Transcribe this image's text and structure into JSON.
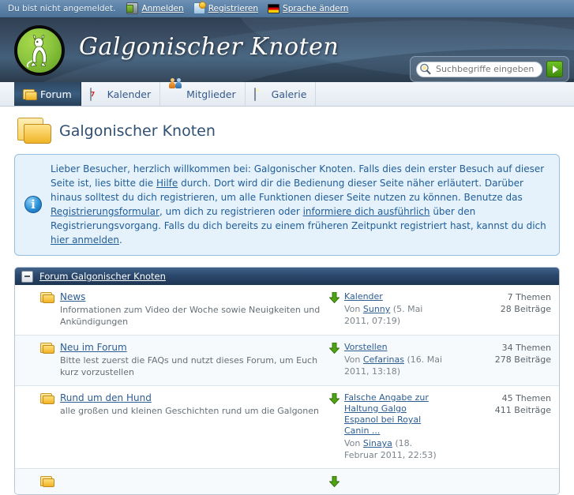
{
  "topbar": {
    "status_text": "Du bist nicht angemeldet.",
    "links": [
      {
        "label": "Anmelden",
        "icon": "login-icon"
      },
      {
        "label": "Registrieren",
        "icon": "register-icon"
      },
      {
        "label": "Sprache ändern",
        "icon": "german-flag-icon"
      }
    ]
  },
  "banner": {
    "site_title": "Galgonischer Knoten",
    "logo_icon": "galgo-dog-logo",
    "accent_green": "#8cc63f",
    "header_dark": "#2f3f52"
  },
  "search": {
    "placeholder": "Suchbegriffe eingeben",
    "value": "",
    "icon": "magnifier-icon",
    "submit_icon": "green-play-arrow-icon"
  },
  "tabs": [
    {
      "label": "Forum",
      "icon": "folder-icon",
      "active": true
    },
    {
      "label": "Kalender",
      "icon": "calendar-icon",
      "active": false,
      "day": "7"
    },
    {
      "label": "Mitglieder",
      "icon": "users-icon",
      "active": false
    },
    {
      "label": "Galerie",
      "icon": "image-icon",
      "active": false
    }
  ],
  "page": {
    "title": "Galgonischer Knoten",
    "icon": "open-folders-icon"
  },
  "notice": {
    "icon": "info-icon",
    "segments": [
      {
        "text": "Lieber Besucher, herzlich willkommen bei: Galgonischer Knoten. Falls dies dein erster Besuch auf dieser Seite ist, lies bitte die ",
        "link": false
      },
      {
        "text": "Hilfe",
        "link": true
      },
      {
        "text": " durch. Dort wird dir die Bedienung dieser Seite näher erläutert. Darüber hinaus solltest du dich registrieren, um alle Funktionen dieser Seite nutzen zu können. Benutze das ",
        "link": false
      },
      {
        "text": "Registrierungsformular",
        "link": true
      },
      {
        "text": ", um dich zu registrieren oder ",
        "link": false
      },
      {
        "text": "informiere dich ausführlich",
        "link": true
      },
      {
        "text": " über den Registrierungsvorgang. Falls du dich bereits zu einem früheren Zeitpunkt registriert hast, kannst du dich ",
        "link": false
      },
      {
        "text": "hier anmelden",
        "link": true
      },
      {
        "text": ".",
        "link": false
      }
    ]
  },
  "board": {
    "header_title": "Forum Galgonischer Knoten",
    "collapse_icon": "minus-icon",
    "rows": [
      {
        "forum_icon": "folder-icon",
        "name": "News",
        "description": "Informationen zum Video der Woche sowie Neuigkeiten und Ankündigungen",
        "arrow_icon": "green-down-arrow-icon",
        "last_post_title": "Kalender",
        "last_post_by_prefix": "Von ",
        "last_post_author": "Sunny",
        "last_post_date": " (5. Mai 2011, 07:19)",
        "topics": "7 Themen",
        "posts": "28 Beiträge"
      },
      {
        "forum_icon": "folder-icon",
        "name": "Neu im Forum",
        "description": "Bitte lest zuerst die FAQs und nutzt dieses Forum, um Euch kurz vorzustellen",
        "arrow_icon": "green-down-arrow-icon",
        "last_post_title": "Vorstellen",
        "last_post_by_prefix": "Von ",
        "last_post_author": "Cefarinas",
        "last_post_date": " (16. Mai 2011, 13:18)",
        "topics": "34 Themen",
        "posts": "278 Beiträge"
      },
      {
        "forum_icon": "folder-icon",
        "name": "Rund um den Hund",
        "description": "alle großen und kleinen Geschichten rund um die Galgonen",
        "arrow_icon": "green-down-arrow-icon",
        "last_post_title": "Falsche Angabe zur Haltung Galgo Espanol bei Royal Canin ...",
        "last_post_by_prefix": "Von ",
        "last_post_author": "Sinaya",
        "last_post_date": " (18. Februar 2011, 22:53)",
        "topics": "45 Themen",
        "posts": "411 Beiträge"
      }
    ]
  }
}
